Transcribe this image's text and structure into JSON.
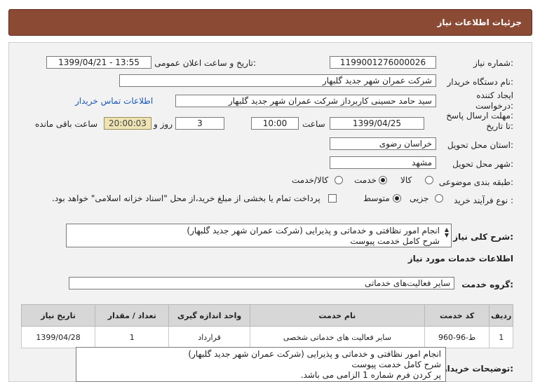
{
  "header": {
    "title": "جزئیات اطلاعات نیاز"
  },
  "form": {
    "need_number": {
      "label": "شماره نیاز:",
      "value": "1199001276000026"
    },
    "announce_datetime": {
      "label": "تاریخ و ساعت اعلان عمومی:",
      "value": "1399/04/21 - 13:55"
    },
    "buyer_org": {
      "label": "نام دستگاه خریدار:",
      "value": "شرکت عمران شهر جدید گلبهار"
    },
    "requester": {
      "label_line1": "ایجاد کننده",
      "label_line2": "درخواست:",
      "value": "سید حامد حسینی کاربرداز شرکت عمران شهر جدید گلبهار",
      "contact_link": "اطلاعات تماس خریدار"
    },
    "deadline": {
      "label_line1": "مهلت ارسال پاسخ:",
      "label_line2": "تا تاریخ:",
      "date": "1399/04/25",
      "time_label": "ساعت",
      "time": "10:00",
      "days": "3",
      "days_label": "روز و",
      "remaining": "20:00:03",
      "remaining_label": "ساعت باقی مانده"
    },
    "province": {
      "label": "استان محل تحویل:",
      "value": "خراسان رضوی"
    },
    "city": {
      "label": "شهر محل تحویل:",
      "value": "مشهد"
    },
    "category": {
      "label": "طبقه بندی موضوعی:",
      "options": [
        "کالا",
        "خدمت",
        "کالا/خدمت"
      ],
      "selected": "خدمت"
    },
    "purchase_process": {
      "label": "نوع فرآیند خرید :",
      "options": [
        "جزیی",
        "متوسط"
      ],
      "selected": "متوسط",
      "payment_note": "پرداخت تمام یا بخشی از مبلغ خرید،از محل \"اسناد خزانه اسلامی\" خواهد بود."
    },
    "summary": {
      "label": "شرح کلی نیاز:",
      "line1": "انجام امور نظافتی و خدماتی و پذیرایی (شرکت عمران شهر جدید گلبهار)",
      "line2": "شرح کامل خدمت پیوست"
    }
  },
  "services": {
    "section_title": "اطلاعات خدمات مورد نیاز",
    "group_label": "گروه خدمت:",
    "group_value": "سایر فعالیت‌های خدماتی",
    "columns": [
      "ردیف",
      "کد خدمت",
      "نام خدمت",
      "واحد اندازه گیری",
      "تعداد / مقدار",
      "تاریخ نیاز"
    ],
    "rows": [
      {
        "row": "1",
        "code": "ط-96-960",
        "name": "سایر فعالیت های خدماتی شخصی",
        "unit": "قرارداد",
        "qty": "1",
        "date": "1399/04/28"
      }
    ]
  },
  "buyer_notes": {
    "label": "توضیحات خریدار:",
    "line1": "انجام امور نظافتی و خدماتی و پذیرایی (شرکت عمران شهر جدید گلبهار)",
    "line2": "شرح کامل خدمت پیوست",
    "line3": "پر کردن فرم شماره 1 الزامی می باشد."
  }
}
